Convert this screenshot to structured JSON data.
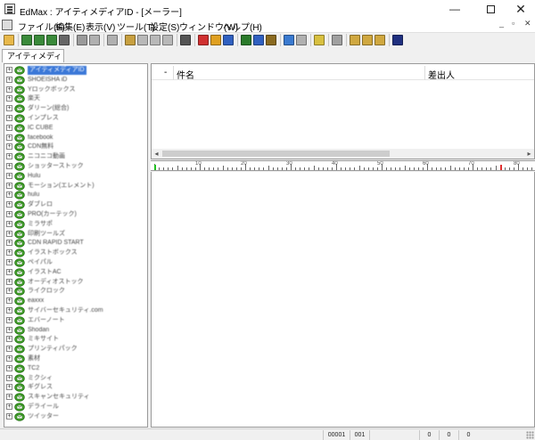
{
  "window": {
    "title": "EdMax : アイティメディアID - [メーラー]",
    "minimize_glyph": "—",
    "close_glyph": "✕"
  },
  "menubar": {
    "items": [
      "ファイル(F)",
      "編集(E)",
      "表示(V)",
      "ツール(T)",
      "設定(S)",
      "ウィンドウ(W)",
      "ヘルプ(H)"
    ],
    "mdi_controls": [
      "_",
      "▫",
      "✕"
    ]
  },
  "toolbar": {
    "buttons": [
      {
        "icon": "folder-open-icon",
        "color": "#e8b84a"
      },
      {
        "sep": true
      },
      {
        "icon": "mailbox-receive-icon",
        "color": "#3a8a3a"
      },
      {
        "icon": "mailbox-receive-all-icon",
        "color": "#3a8a3a"
      },
      {
        "icon": "mailbox-send-icon",
        "color": "#3a8a3a"
      },
      {
        "icon": "mailbox-stop-icon",
        "color": "#666666"
      },
      {
        "sep": true
      },
      {
        "icon": "disabled-circle-icon",
        "color": "#9a9a9a"
      },
      {
        "icon": "disabled-print-icon",
        "color": "#b0b0b0"
      },
      {
        "sep": true
      },
      {
        "icon": "disabled-reply-icon",
        "color": "#b0b0b0"
      },
      {
        "sep": true
      },
      {
        "icon": "new-mail-icon",
        "color": "#c8a040"
      },
      {
        "icon": "reply-icon",
        "color": "#b8b8b8"
      },
      {
        "icon": "reply-all-icon",
        "color": "#b8b8b8"
      },
      {
        "icon": "forward-icon",
        "color": "#b8b8b8"
      },
      {
        "sep": true
      },
      {
        "icon": "address-book-icon",
        "color": "#555555"
      },
      {
        "sep": true
      },
      {
        "icon": "mark-red-icon",
        "color": "#d03030"
      },
      {
        "icon": "flag-diamond-icon",
        "color": "#e0a020"
      },
      {
        "icon": "mark-blue-icon",
        "color": "#3060c0"
      },
      {
        "sep": true
      },
      {
        "icon": "attach-icon",
        "color": "#2a7a2a"
      },
      {
        "icon": "filter-icon",
        "color": "#3060c0"
      },
      {
        "icon": "tools-icon",
        "color": "#8a6a20"
      },
      {
        "sep": true
      },
      {
        "icon": "arrow-left-icon",
        "color": "#3a7ad0"
      },
      {
        "icon": "arrow-right-icon",
        "color": "#b0b0b0"
      },
      {
        "sep": true
      },
      {
        "icon": "note-icon",
        "color": "#d8c040"
      },
      {
        "sep": true
      },
      {
        "icon": "delete-icon",
        "color": "#a0a0a0"
      },
      {
        "sep": true
      },
      {
        "icon": "layout-1-icon",
        "color": "#d0a840"
      },
      {
        "icon": "layout-2-icon",
        "color": "#d0a840"
      },
      {
        "icon": "layout-3-icon",
        "color": "#d0a840"
      },
      {
        "sep": true
      },
      {
        "icon": "help-icon",
        "color": "#203080"
      }
    ]
  },
  "tabs": [
    {
      "label": "アイティメディアID"
    }
  ],
  "tree": {
    "items": [
      "アイティメディアID",
      "SHOEISHA iD",
      "Yロックボックス",
      "楽天",
      "ダリーン(総合)",
      "インプレス",
      "IC CUBE",
      "facebook",
      "CDN無料",
      "ニコニコ動画",
      "ショッターストック",
      "Hulu",
      "モーション(エレメント)",
      "hulu",
      "ダブレロ",
      "PRO(カーテック)",
      "ミラサポ",
      "印刷ツールズ",
      "CDN RAPID START",
      "イラストボックス",
      "ペイパル",
      "イラストAC",
      "オーディオストック",
      "ライクロック",
      "eaxxx",
      "サイバーセキュリティ.com",
      "エバーノート",
      "Shodan",
      "ミキサイト",
      "プリンティパック",
      "素材",
      "TC2",
      "ミクシィ",
      "ギグレス",
      "スキャンセキュリティ",
      "デライール",
      "ツイッター"
    ],
    "expander_glyph": "+"
  },
  "list": {
    "columns": [
      {
        "label": "-"
      },
      {
        "label": "件名"
      },
      {
        "label": "差出人"
      }
    ],
    "scroll_left": "◂",
    "scroll_right": "▸"
  },
  "ruler": {
    "labels": [
      "10",
      "20",
      "30",
      "40",
      "50",
      "60",
      "70",
      "80"
    ]
  },
  "statusbar": {
    "cells": [
      "00001",
      "001",
      "",
      "0",
      "0",
      "0"
    ]
  },
  "colors": {
    "selection": "#3b78d8",
    "mailbox_green": "#4caf30",
    "ruler_mark_green": "#20c020",
    "ruler_mark_red": "#e03030"
  }
}
